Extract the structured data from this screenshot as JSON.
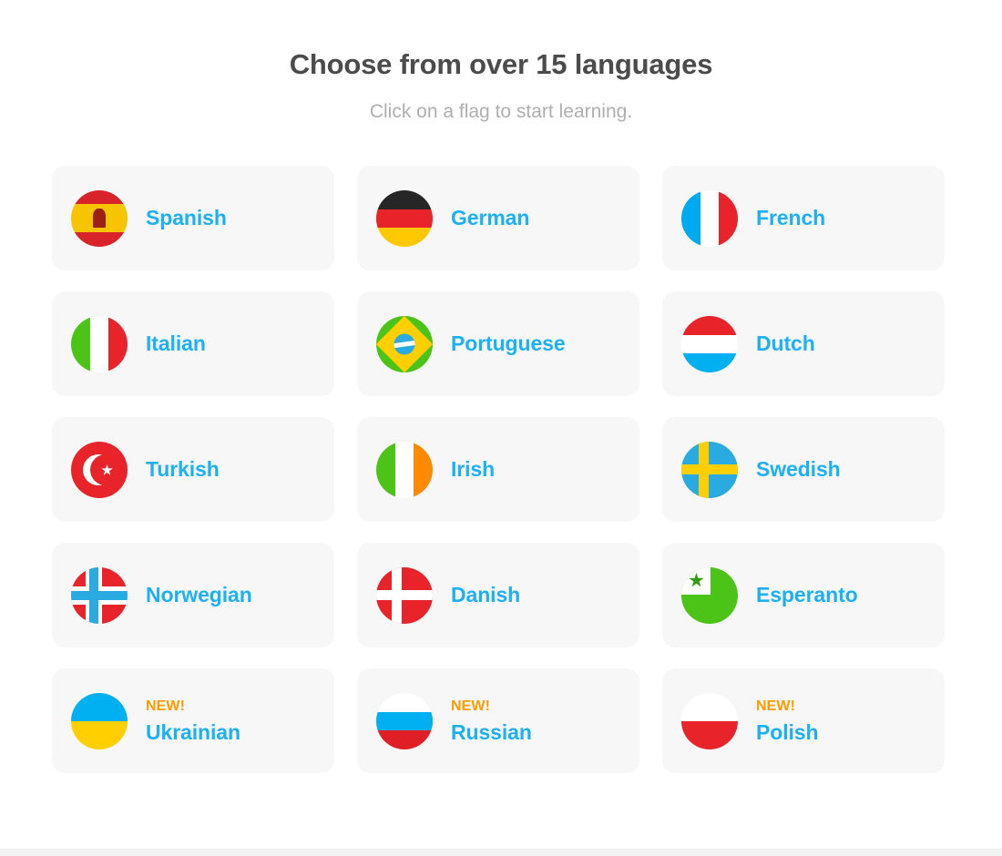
{
  "header": {
    "title": "Choose from over 15 languages",
    "subtitle": "Click on a flag to start learning."
  },
  "colors": {
    "title": "#4b4b4b",
    "subtitle": "#afafaf",
    "language_label": "#1cb0f6",
    "new_badge": "#ff9c00",
    "tile_background": "#f7f7f7",
    "page_background": "#ffffff"
  },
  "badges": {
    "new_label": "NEW!"
  },
  "languages": [
    {
      "label": "Spanish",
      "flag": "flag-spain",
      "new": false
    },
    {
      "label": "German",
      "flag": "flag-germany",
      "new": false
    },
    {
      "label": "French",
      "flag": "flag-france",
      "new": false
    },
    {
      "label": "Italian",
      "flag": "flag-italy",
      "new": false
    },
    {
      "label": "Portuguese",
      "flag": "flag-brazil",
      "new": false
    },
    {
      "label": "Dutch",
      "flag": "flag-netherlands",
      "new": false
    },
    {
      "label": "Turkish",
      "flag": "flag-turkey",
      "new": false
    },
    {
      "label": "Irish",
      "flag": "flag-ireland",
      "new": false
    },
    {
      "label": "Swedish",
      "flag": "flag-sweden",
      "new": false
    },
    {
      "label": "Norwegian",
      "flag": "flag-norway",
      "new": false
    },
    {
      "label": "Danish",
      "flag": "flag-denmark",
      "new": false
    },
    {
      "label": "Esperanto",
      "flag": "flag-esperanto",
      "new": false
    },
    {
      "label": "Ukrainian",
      "flag": "flag-ukraine",
      "new": true
    },
    {
      "label": "Russian",
      "flag": "flag-russia",
      "new": true
    },
    {
      "label": "Polish",
      "flag": "flag-poland",
      "new": true
    }
  ]
}
